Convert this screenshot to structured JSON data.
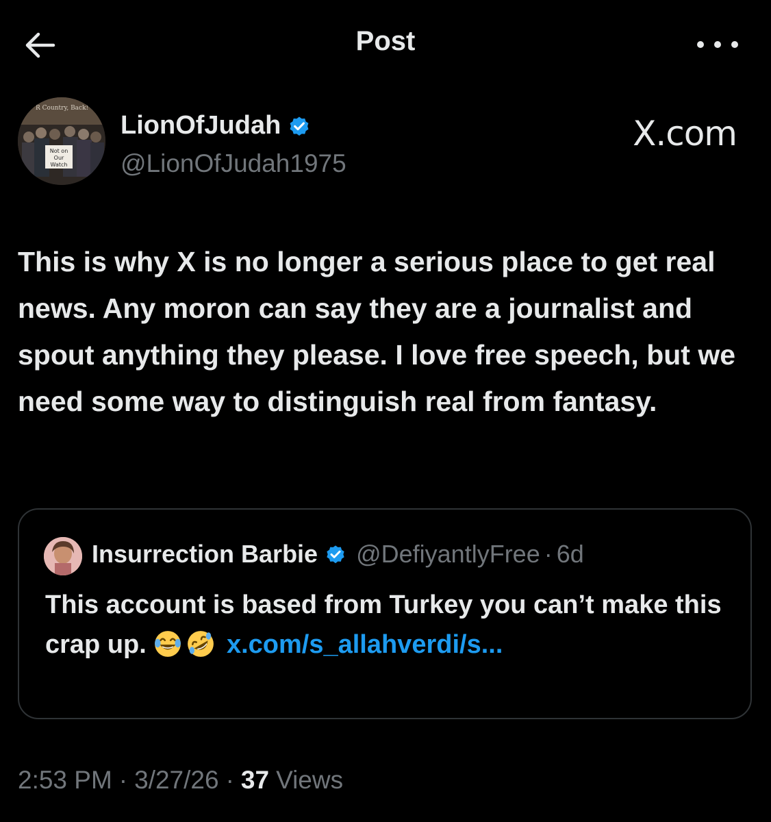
{
  "header": {
    "title": "Post",
    "back_icon": "arrow-left-icon",
    "more_icon": "more-horizontal-icon"
  },
  "post": {
    "author_name": "LionOfJudah",
    "author_handle": "@LionOfJudah1975",
    "verified": true,
    "avatar_sign_text": "Not on Our Watch",
    "watermark": "X.com",
    "body": "This is why X is no longer a serious place to get real news. Any moron can say they are a journalist and spout anything they please. I love free speech, but we need some way to distinguish real from fantasy."
  },
  "quote": {
    "author_name": "Insurrection Barbie",
    "author_handle": "@DefiyantlyFree",
    "separator": "·",
    "time": "6d",
    "verified": true,
    "text": "This account is based from Turkey you can’t make this crap up.",
    "emojis": [
      "face-with-tears-of-joy",
      "rolling-on-floor-laughing"
    ],
    "link_text": "x.com/s_allahverdi/s..."
  },
  "meta": {
    "time": "2:53 PM",
    "separator": "·",
    "date": "3/27/26",
    "views_count": "37",
    "views_label": "Views"
  },
  "colors": {
    "background": "#000000",
    "text_primary": "#e7e9ea",
    "text_secondary": "#71767b",
    "accent": "#1d9bf0",
    "border": "#2f3336"
  }
}
